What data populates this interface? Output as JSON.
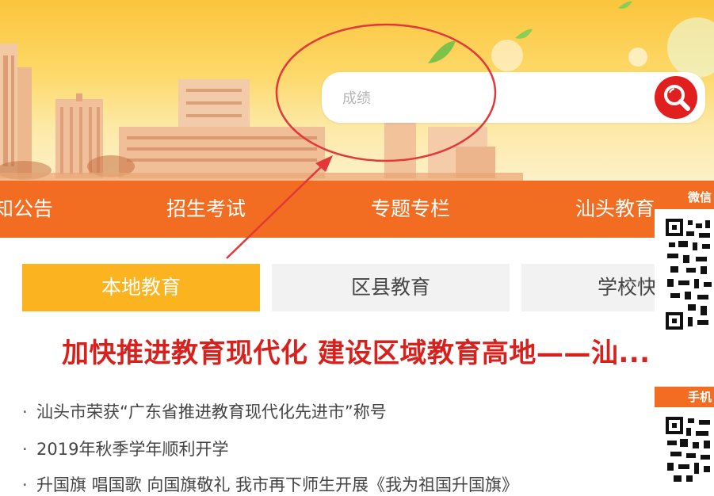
{
  "search": {
    "placeholder": "成绩"
  },
  "nav": {
    "items": [
      "知公告",
      "招生考试",
      "专题专栏",
      "汕头教育"
    ]
  },
  "tabs": [
    "本地教育",
    "区县教育",
    "学校快"
  ],
  "headline": "加快推进教育现代化 建设区域教育高地——汕...",
  "news": [
    "汕头市荣获“广东省推进教育现代化先进市”称号",
    "2019年秋季学年顺利开学",
    "升国旗 唱国歌 向国旗敬礼 我市再下师生开展《我为祖国升国旗》"
  ],
  "sidebar": {
    "wechat_label": "微信",
    "mobile_label": "手机"
  },
  "colors": {
    "nav_bg": "#f26d21",
    "active_tab": "#fbb320",
    "headline": "#d8201c",
    "search_button": "#e11f1f"
  },
  "icons": {
    "search": "magnifier-icon"
  }
}
